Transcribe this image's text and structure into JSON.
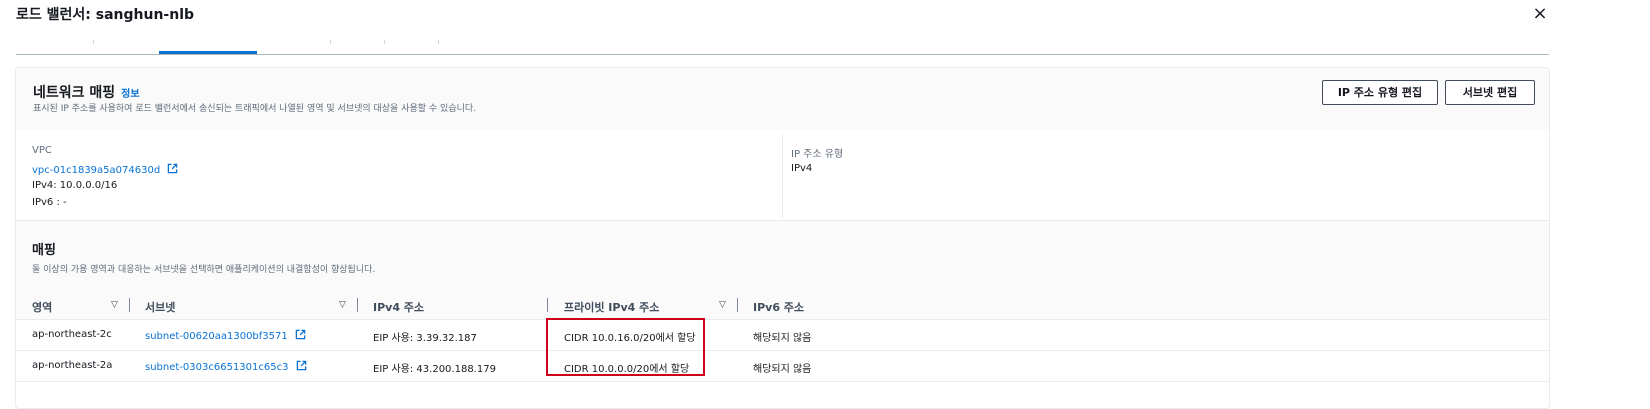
{
  "modal": {
    "title": "로드 밸런서: sanghun-nlb",
    "close_icon": "×"
  },
  "tabs": [
    {
      "label": ""
    },
    {
      "label": ""
    },
    {
      "label": ""
    },
    {
      "label": ""
    },
    {
      "label": ""
    },
    {
      "label": ""
    }
  ],
  "network_mapping": {
    "title": "네트워크 매핑",
    "info_label": "정보",
    "description": "표시된 IP 주소를 사용하여 로드 밸런서에서 송신되는 트래픽에서 나열된 영역 및 서브넷의 대상을 사용할 수 있습니다.",
    "edit_ip_type_button": "IP 주소 유형 편집",
    "edit_subnet_button": "서브넷 편집",
    "vpc_label": "VPC",
    "vpc_id": "vpc-01c1839a5a074630d",
    "ipv4_cidr": "IPv4: 10.0.0.0/16",
    "ipv6_cidr": "IPv6 : -",
    "ip_type_label": "IP 주소 유형",
    "ip_type_value": "IPv4"
  },
  "mapping": {
    "title": "매핑",
    "description": "둘 이상의 가용 영역과 대응하는 서브넷을 선택하면 애플리케이션의 내결함성이 향상됩니다.",
    "columns": [
      "영역",
      "서브넷",
      "IPv4 주소",
      "프라이빗 IPv4 주소",
      "IPv6 주소"
    ],
    "rows": [
      {
        "zone": "ap-northeast-2c",
        "subnet": "subnet-00620aa1300bf3571",
        "ipv4": "EIP 사용: 3.39.32.187",
        "private_ipv4": "CIDR 10.0.16.0/20에서 할당",
        "ipv6": "해당되지 않음"
      },
      {
        "zone": "ap-northeast-2a",
        "subnet": "subnet-0303c6651301c65c3",
        "ipv4": "EIP 사용: 43.200.188.179",
        "private_ipv4": "CIDR 10.0.0.0/20에서 할당",
        "ipv6": "해당되지 않음"
      }
    ]
  },
  "colors": {
    "link": "#0972d3",
    "highlight": "#d0021b"
  }
}
